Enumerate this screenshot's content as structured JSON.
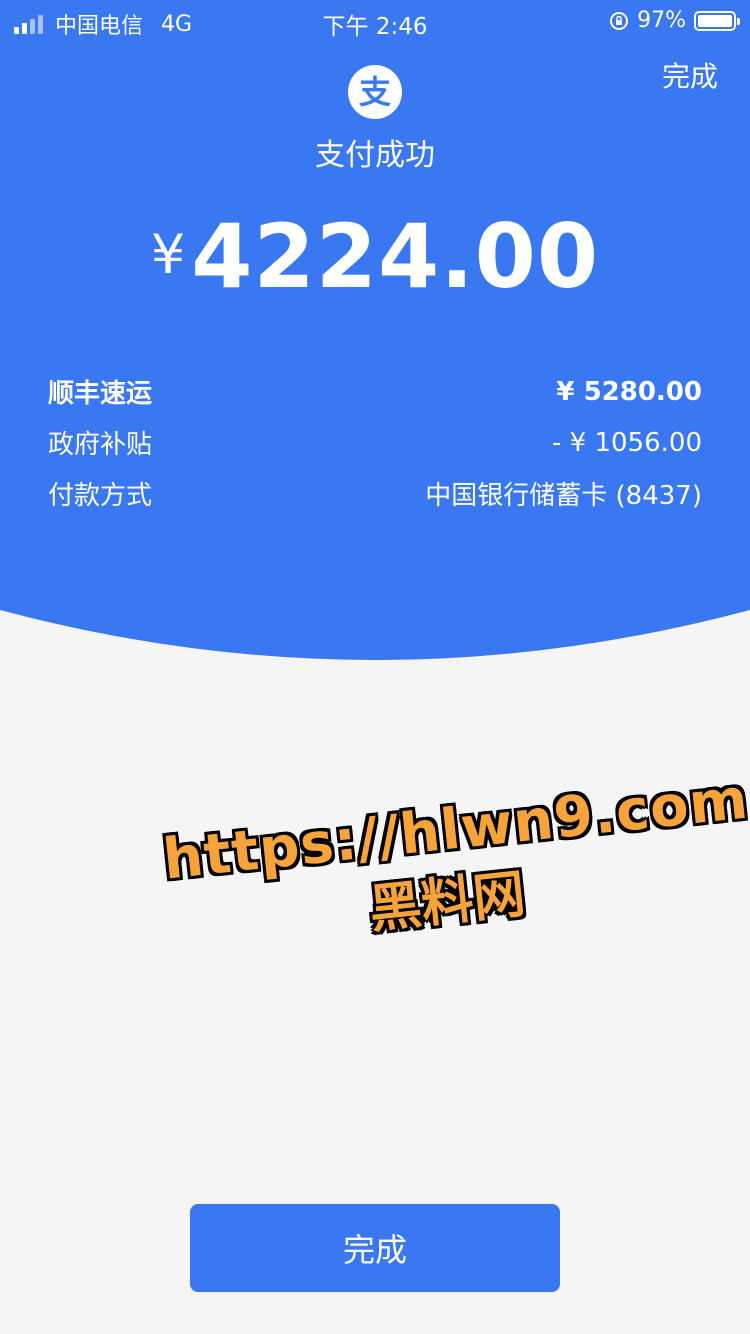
{
  "colors": {
    "brand_blue": "#3a78f2",
    "background": "#f5f5f5",
    "text_on_blue": "#ffffff",
    "watermark_orange": "#f5a33a"
  },
  "status_bar": {
    "carrier": "中国电信",
    "network": "4G",
    "time": "下午 2:46",
    "battery": "97%",
    "icons": [
      "signal-icon",
      "orientation-lock-icon",
      "battery-icon"
    ]
  },
  "header": {
    "done_label": "完成",
    "logo_glyph": "支",
    "title": "支付成功",
    "amount_currency": "¥",
    "amount_value": "4224.00"
  },
  "details": [
    {
      "label": "顺丰速运",
      "value": "¥ 5280.00"
    },
    {
      "label": "政府补贴",
      "value": "- ¥ 1056.00"
    },
    {
      "label": "付款方式",
      "value": "中国银行储蓄卡 (8437)"
    }
  ],
  "watermark": {
    "url_text": "https://hlwn9.com",
    "site_name": "黑料网"
  },
  "footer": {
    "done_button_label": "完成"
  }
}
